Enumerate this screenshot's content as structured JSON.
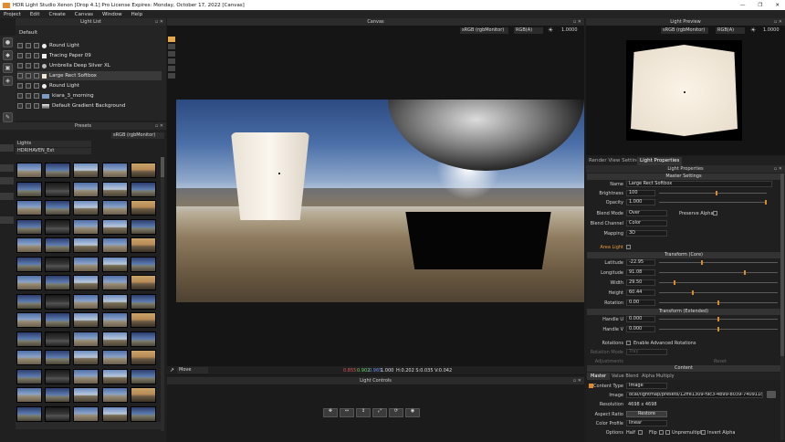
{
  "window": {
    "title": "HDR Light Studio Xenon [Drop 4.1] Pro License Expires: Monday, October 17, 2022  [Canvas]",
    "controls": [
      "—",
      "❐",
      "✕"
    ]
  },
  "menu": [
    "Project",
    "Edit",
    "Create",
    "Canvas",
    "Window",
    "Help"
  ],
  "light_list": {
    "title": "Light List",
    "preset": "Default",
    "items": [
      {
        "name": "Round Light",
        "selected": false
      },
      {
        "name": "Tracing Paper 09",
        "selected": false
      },
      {
        "name": "Umbrella Deep Silver XL",
        "selected": false
      },
      {
        "name": "Large Rect Softbox",
        "selected": true
      },
      {
        "name": "Round Light",
        "selected": false
      },
      {
        "name": "kiara_3_morning",
        "selected": false
      },
      {
        "name": "Default Gradient Background",
        "selected": false
      }
    ]
  },
  "presets": {
    "title": "Presets",
    "colorspace": "sRGB (rgbMonitor)",
    "category": "Lights",
    "collection": "HDRIHAVEN_Ext"
  },
  "canvas": {
    "title": "Canvas",
    "colorspace": "sRGB (rgbMonitor)",
    "channel": "RGB(A)",
    "exposure": "1.0000",
    "mode": "Move",
    "readout_rgb": [
      "0.855",
      "0.902",
      "0.965"
    ],
    "readout_alpha": "1.000",
    "readout_coords": "H:0.202 S:0.035 V:0.042",
    "controls_title": "Light Controls"
  },
  "light_preview": {
    "title": "Light Preview",
    "colorspace": "sRGB (rgbMonitor)",
    "channel": "RGB(A)",
    "exposure": "1.0000"
  },
  "props": {
    "tabs": [
      "Render View Settings",
      "Light Properties"
    ],
    "title": "Light Properties",
    "master_settings": "Master Settings",
    "name_label": "Name",
    "name": "Large Rect Softbox",
    "brightness_label": "Brightness",
    "brightness": "100",
    "opacity_label": "Opacity",
    "opacity": "1.000",
    "blend_mode_label": "Blend Mode",
    "blend_mode": "Over",
    "preserve_alpha": "Preserve Alpha",
    "blend_channel_label": "Blend Channel",
    "blend_channel": "Color",
    "mapping_label": "Mapping",
    "mapping": "3D",
    "area_light": "Area Light",
    "transform_core": "Transform (Core)",
    "latitude_label": "Latitude",
    "latitude": "-22.95",
    "longitude_label": "Longitude",
    "longitude": "91.08",
    "width_label": "Width",
    "width": "29.50",
    "height_label": "Height",
    "height": "60.44",
    "rotation_label": "Rotation",
    "rotation": "0.00",
    "transform_ext": "Transform (Extended)",
    "handle_u_label": "Handle U",
    "handle_u": "0.000",
    "handle_v_label": "Handle V",
    "handle_v": "0.000",
    "rotations_label": "Rotations",
    "adv_rotations": "Enable Advanced Rotations",
    "rotation_mode_label": "Rotation Mode",
    "rotation_mode": "Tray",
    "adjustments_label": "Adjustments",
    "reset": "Reset",
    "content": "Content",
    "content_tabs": [
      "Master",
      "Value Blend",
      "Alpha Multiply"
    ],
    "content_type_label": "Content Type",
    "content_type": "Image",
    "image_label": "Image",
    "image_path": "ocal/lightmap/presets/12ffe1309-f9c3-4b99-8039-740911d08086.tx",
    "resolution_label": "Resolution",
    "resolution": "4698 x 4698",
    "aspect_label": "Aspect Ratio",
    "restore": "Restore",
    "color_profile_label": "Color Profile",
    "color_profile": "linear",
    "options_label": "Options",
    "half": "Half",
    "flip": "Flip",
    "unpremultiply": "Unpremultiply",
    "invert_alpha": "Invert Alpha"
  }
}
